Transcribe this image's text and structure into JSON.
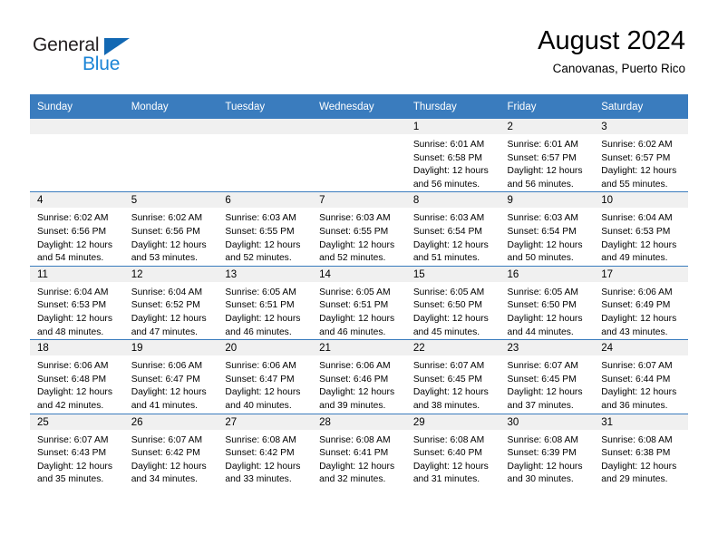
{
  "brand": {
    "name_part1": "General",
    "name_part2": "Blue",
    "logo_icon": "triangle-logo-icon",
    "color_dark": "#231f20",
    "color_blue": "#1a84d6"
  },
  "header": {
    "title": "August 2024",
    "subtitle": "Canovanas, Puerto Rico"
  },
  "calendar": {
    "header_bg": "#3a7cbe",
    "daynum_bg": "#f0f0f0",
    "weekday_headers": [
      "Sunday",
      "Monday",
      "Tuesday",
      "Wednesday",
      "Thursday",
      "Friday",
      "Saturday"
    ],
    "weeks": [
      [
        {
          "day": "",
          "empty": true,
          "line1": "",
          "line2": "",
          "line3": "",
          "line4": ""
        },
        {
          "day": "",
          "empty": true,
          "line1": "",
          "line2": "",
          "line3": "",
          "line4": ""
        },
        {
          "day": "",
          "empty": true,
          "line1": "",
          "line2": "",
          "line3": "",
          "line4": ""
        },
        {
          "day": "",
          "empty": true,
          "line1": "",
          "line2": "",
          "line3": "",
          "line4": ""
        },
        {
          "day": "1",
          "empty": false,
          "line1": "Sunrise: 6:01 AM",
          "line2": "Sunset: 6:58 PM",
          "line3": "Daylight: 12 hours",
          "line4": "and 56 minutes."
        },
        {
          "day": "2",
          "empty": false,
          "line1": "Sunrise: 6:01 AM",
          "line2": "Sunset: 6:57 PM",
          "line3": "Daylight: 12 hours",
          "line4": "and 56 minutes."
        },
        {
          "day": "3",
          "empty": false,
          "line1": "Sunrise: 6:02 AM",
          "line2": "Sunset: 6:57 PM",
          "line3": "Daylight: 12 hours",
          "line4": "and 55 minutes."
        }
      ],
      [
        {
          "day": "4",
          "empty": false,
          "line1": "Sunrise: 6:02 AM",
          "line2": "Sunset: 6:56 PM",
          "line3": "Daylight: 12 hours",
          "line4": "and 54 minutes."
        },
        {
          "day": "5",
          "empty": false,
          "line1": "Sunrise: 6:02 AM",
          "line2": "Sunset: 6:56 PM",
          "line3": "Daylight: 12 hours",
          "line4": "and 53 minutes."
        },
        {
          "day": "6",
          "empty": false,
          "line1": "Sunrise: 6:03 AM",
          "line2": "Sunset: 6:55 PM",
          "line3": "Daylight: 12 hours",
          "line4": "and 52 minutes."
        },
        {
          "day": "7",
          "empty": false,
          "line1": "Sunrise: 6:03 AM",
          "line2": "Sunset: 6:55 PM",
          "line3": "Daylight: 12 hours",
          "line4": "and 52 minutes."
        },
        {
          "day": "8",
          "empty": false,
          "line1": "Sunrise: 6:03 AM",
          "line2": "Sunset: 6:54 PM",
          "line3": "Daylight: 12 hours",
          "line4": "and 51 minutes."
        },
        {
          "day": "9",
          "empty": false,
          "line1": "Sunrise: 6:03 AM",
          "line2": "Sunset: 6:54 PM",
          "line3": "Daylight: 12 hours",
          "line4": "and 50 minutes."
        },
        {
          "day": "10",
          "empty": false,
          "line1": "Sunrise: 6:04 AM",
          "line2": "Sunset: 6:53 PM",
          "line3": "Daylight: 12 hours",
          "line4": "and 49 minutes."
        }
      ],
      [
        {
          "day": "11",
          "empty": false,
          "line1": "Sunrise: 6:04 AM",
          "line2": "Sunset: 6:53 PM",
          "line3": "Daylight: 12 hours",
          "line4": "and 48 minutes."
        },
        {
          "day": "12",
          "empty": false,
          "line1": "Sunrise: 6:04 AM",
          "line2": "Sunset: 6:52 PM",
          "line3": "Daylight: 12 hours",
          "line4": "and 47 minutes."
        },
        {
          "day": "13",
          "empty": false,
          "line1": "Sunrise: 6:05 AM",
          "line2": "Sunset: 6:51 PM",
          "line3": "Daylight: 12 hours",
          "line4": "and 46 minutes."
        },
        {
          "day": "14",
          "empty": false,
          "line1": "Sunrise: 6:05 AM",
          "line2": "Sunset: 6:51 PM",
          "line3": "Daylight: 12 hours",
          "line4": "and 46 minutes."
        },
        {
          "day": "15",
          "empty": false,
          "line1": "Sunrise: 6:05 AM",
          "line2": "Sunset: 6:50 PM",
          "line3": "Daylight: 12 hours",
          "line4": "and 45 minutes."
        },
        {
          "day": "16",
          "empty": false,
          "line1": "Sunrise: 6:05 AM",
          "line2": "Sunset: 6:50 PM",
          "line3": "Daylight: 12 hours",
          "line4": "and 44 minutes."
        },
        {
          "day": "17",
          "empty": false,
          "line1": "Sunrise: 6:06 AM",
          "line2": "Sunset: 6:49 PM",
          "line3": "Daylight: 12 hours",
          "line4": "and 43 minutes."
        }
      ],
      [
        {
          "day": "18",
          "empty": false,
          "line1": "Sunrise: 6:06 AM",
          "line2": "Sunset: 6:48 PM",
          "line3": "Daylight: 12 hours",
          "line4": "and 42 minutes."
        },
        {
          "day": "19",
          "empty": false,
          "line1": "Sunrise: 6:06 AM",
          "line2": "Sunset: 6:47 PM",
          "line3": "Daylight: 12 hours",
          "line4": "and 41 minutes."
        },
        {
          "day": "20",
          "empty": false,
          "line1": "Sunrise: 6:06 AM",
          "line2": "Sunset: 6:47 PM",
          "line3": "Daylight: 12 hours",
          "line4": "and 40 minutes."
        },
        {
          "day": "21",
          "empty": false,
          "line1": "Sunrise: 6:06 AM",
          "line2": "Sunset: 6:46 PM",
          "line3": "Daylight: 12 hours",
          "line4": "and 39 minutes."
        },
        {
          "day": "22",
          "empty": false,
          "line1": "Sunrise: 6:07 AM",
          "line2": "Sunset: 6:45 PM",
          "line3": "Daylight: 12 hours",
          "line4": "and 38 minutes."
        },
        {
          "day": "23",
          "empty": false,
          "line1": "Sunrise: 6:07 AM",
          "line2": "Sunset: 6:45 PM",
          "line3": "Daylight: 12 hours",
          "line4": "and 37 minutes."
        },
        {
          "day": "24",
          "empty": false,
          "line1": "Sunrise: 6:07 AM",
          "line2": "Sunset: 6:44 PM",
          "line3": "Daylight: 12 hours",
          "line4": "and 36 minutes."
        }
      ],
      [
        {
          "day": "25",
          "empty": false,
          "line1": "Sunrise: 6:07 AM",
          "line2": "Sunset: 6:43 PM",
          "line3": "Daylight: 12 hours",
          "line4": "and 35 minutes."
        },
        {
          "day": "26",
          "empty": false,
          "line1": "Sunrise: 6:07 AM",
          "line2": "Sunset: 6:42 PM",
          "line3": "Daylight: 12 hours",
          "line4": "and 34 minutes."
        },
        {
          "day": "27",
          "empty": false,
          "line1": "Sunrise: 6:08 AM",
          "line2": "Sunset: 6:42 PM",
          "line3": "Daylight: 12 hours",
          "line4": "and 33 minutes."
        },
        {
          "day": "28",
          "empty": false,
          "line1": "Sunrise: 6:08 AM",
          "line2": "Sunset: 6:41 PM",
          "line3": "Daylight: 12 hours",
          "line4": "and 32 minutes."
        },
        {
          "day": "29",
          "empty": false,
          "line1": "Sunrise: 6:08 AM",
          "line2": "Sunset: 6:40 PM",
          "line3": "Daylight: 12 hours",
          "line4": "and 31 minutes."
        },
        {
          "day": "30",
          "empty": false,
          "line1": "Sunrise: 6:08 AM",
          "line2": "Sunset: 6:39 PM",
          "line3": "Daylight: 12 hours",
          "line4": "and 30 minutes."
        },
        {
          "day": "31",
          "empty": false,
          "line1": "Sunrise: 6:08 AM",
          "line2": "Sunset: 6:38 PM",
          "line3": "Daylight: 12 hours",
          "line4": "and 29 minutes."
        }
      ]
    ]
  }
}
